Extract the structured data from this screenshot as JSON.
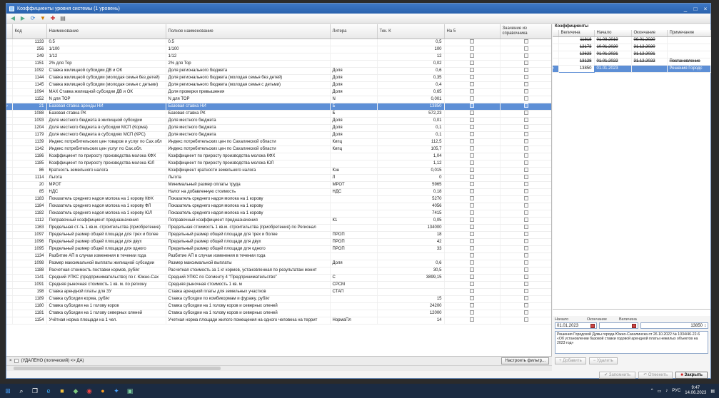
{
  "window": {
    "title": "Коэффициенты уровня системы (1 уровень)",
    "controls": [
      "_",
      "□",
      "×"
    ]
  },
  "toolbar": {
    "buttons": [
      "back-icon",
      "forward-icon",
      "refresh-icon",
      "filter-icon",
      "tools-icon",
      "print-icon"
    ]
  },
  "grid": {
    "columns": {
      "code": "Код",
      "name": "Наименование",
      "full_name": "Полное наименование",
      "litera": "Литера",
      "tek_k": "Тек. К",
      "na5": "На 5",
      "from_ref": "Значение из справочника"
    },
    "rows": [
      {
        "code": "1133",
        "name": "0.5",
        "full": "0.5",
        "lit": "",
        "k": "0,5"
      },
      {
        "code": "256",
        "name": "1/100",
        "full": "1/100",
        "lit": "",
        "k": "100"
      },
      {
        "code": "249",
        "name": "1/12",
        "full": "1/12",
        "lit": "",
        "k": "12"
      },
      {
        "code": "1151",
        "name": "2% для Тор",
        "full": "2% для Тор",
        "lit": "",
        "k": "0,02"
      },
      {
        "code": "1092",
        "name": "Ставка жилищной субсидии ДВ и ОК",
        "full": "Доля регионального бюджета",
        "lit": "Доля",
        "k": "0,6"
      },
      {
        "code": "1144",
        "name": "Ставка жилищной субсидии (молодая семья без детей)",
        "full": "Доля регионального бюджета (молодая семья без детей)",
        "lit": "Доля",
        "k": "0,35"
      },
      {
        "code": "1145",
        "name": "Ставка жилищной субсидии (молодая семья с детьми)",
        "full": "Доля регионального бюджета (молодая семья с детьми)",
        "lit": "Доля",
        "k": "0,4"
      },
      {
        "code": "1094",
        "name": "MAX Ставка жилищной субсидии ДВ и ОК",
        "full": "Доля проверки превышения",
        "lit": "Доля",
        "k": "0,65"
      },
      {
        "code": "1152",
        "name": "N для ТОР",
        "full": "N для ТОР",
        "lit": "N",
        "k": "0,001"
      },
      {
        "code": "21",
        "name": "Базовая ставка аренды НИ",
        "full": "Базовая ставка НИ",
        "lit": "Б",
        "k": "13850",
        "selected": true
      },
      {
        "code": "1088",
        "name": "Базовая ставка РК",
        "full": "Базовая ставка РК",
        "lit": "Б",
        "k": "572,23"
      },
      {
        "code": "1093",
        "name": "Доля местного бюджета в жилищной субсидии",
        "full": "Доля местного бюджета",
        "lit": "Доля",
        "k": "0,01"
      },
      {
        "code": "1204",
        "name": "Доля местного бюджета в субсидии МСП (Корма)",
        "full": "Доля местного бюджета",
        "lit": "Доля",
        "k": "0,1"
      },
      {
        "code": "1179",
        "name": "Доля местного бюджета в субсидиях МСП (КРС)",
        "full": "Доля местного бюджета",
        "lit": "Доля",
        "k": "0,1"
      },
      {
        "code": "1139",
        "name": "Индекс потребительских цен товаров и услуг по Сах.обл",
        "full": "Индекс потребительских цен по Сахалинской области",
        "lit": "Кипц",
        "k": "112,5"
      },
      {
        "code": "1142",
        "name": "Индекс потребительских цен услуг по Сах.обл.",
        "full": "Индекс потребительских цен по Сахалинской области",
        "lit": "Кипц",
        "k": "105,7"
      },
      {
        "code": "1186",
        "name": "Коэффициент по приросту производства молока КФХ",
        "full": "Коэффициент по приросту производства молока КФХ",
        "lit": "",
        "k": "1,04"
      },
      {
        "code": "1185",
        "name": "Коэффициент по приросту производства молока ЮЛ",
        "full": "Коэффициент по приросту производства молока ЮЛ",
        "lit": "",
        "k": "1,12"
      },
      {
        "code": "86",
        "name": "Кратность земельного налога",
        "full": "Коэффициент кратности земельного налога",
        "lit": "Кзн",
        "k": "0,015"
      },
      {
        "code": "1114",
        "name": "Льгота",
        "full": "Льгота",
        "lit": "Л",
        "k": "0"
      },
      {
        "code": "20",
        "name": "МРОТ",
        "full": "Минимальный размер оплаты труда",
        "lit": "МРОТ",
        "k": "5965"
      },
      {
        "code": "85",
        "name": "НДС",
        "full": "Налог на добавленную стоимость",
        "lit": "НДС",
        "k": "0,18"
      },
      {
        "code": "1183",
        "name": "Показатель среднего надоя молока на 1 корову КФХ",
        "full": "Показатель среднего надоя молока на 1 корову",
        "lit": "",
        "k": "5270"
      },
      {
        "code": "1184",
        "name": "Показатель среднего надоя молока на 1 корову ФЛ",
        "full": "Показатель среднего надоя молока на 1 корову",
        "lit": "",
        "k": "4056"
      },
      {
        "code": "1182",
        "name": "Показатель среднего надоя молока на 1 корову ЮЛ",
        "full": "Показатель среднего надоя молока на 1 корову",
        "lit": "",
        "k": "7415"
      },
      {
        "code": "1112",
        "name": "Поправочный коэффициент предназначения",
        "full": "Поправочный коэффициент предназначения",
        "lit": "К1",
        "k": "0,05"
      },
      {
        "code": "1163",
        "name": "Предельная ст-ть 1 кв.м. строительства (приобретение)",
        "full": "Предельная стоимость 1 кв.м. строительства (приобретения) по Регионал",
        "lit": "",
        "k": "134000"
      },
      {
        "code": "1097",
        "name": "Предельный размер общей площади для трех и более",
        "full": "Предельный размер общей площади для трех и более",
        "lit": "ПРОП",
        "k": "18"
      },
      {
        "code": "1096",
        "name": "Предельный размер общей площади для двух",
        "full": "Предельный размер общей площади для двух",
        "lit": "ПРОП",
        "k": "42"
      },
      {
        "code": "1095",
        "name": "Предельный размер общей площади для одного",
        "full": "Предельный размер общей площади для одного",
        "lit": "ПРОП",
        "k": "33"
      },
      {
        "code": "1134",
        "name": "Разбитие АП в случае изменения в течении года",
        "full": "Разбитие АП в случае изменения в течении года",
        "lit": "",
        "k": ""
      },
      {
        "code": "1098",
        "name": "Размер максимальной выплаты жилищной субсидии",
        "full": "Размер максимальной выплаты",
        "lit": "Доля",
        "k": "0,6"
      },
      {
        "code": "1188",
        "name": "Расчетная стоимость поставки кормов, руб/кг",
        "full": "Расчетная стоимость за 1 кг кормов, установленная по результатам монит",
        "lit": "",
        "k": "30,5"
      },
      {
        "code": "1141",
        "name": "Средний УПКС (предпринимательство) по г. Южно-Сах",
        "full": "Средний УПКС по Сегменту 4 \"Предпринимательство\"",
        "lit": "С",
        "k": "3899,15"
      },
      {
        "code": "1091",
        "name": "Средняя рыночная стоимость 1 кв. м. по региону",
        "full": "Средняя рыночная стоимость 1 кв. м",
        "lit": "СРСМ",
        "k": ""
      },
      {
        "code": "198",
        "name": "Ставка арендной платы для ЗУ",
        "full": "Ставка арендной платы для земельных участков",
        "lit": "СТАП",
        "k": ""
      },
      {
        "code": "1189",
        "name": "Ставка субсидии корма, руб/кг",
        "full": "Ставка субсидии по комбикормам и фуражу, руб/кг",
        "lit": "",
        "k": "15"
      },
      {
        "code": "1180",
        "name": "Ставка субсидии на 1 голову коров",
        "full": "Ставка субсидии на 1 голову коров и северных оленей",
        "lit": "",
        "k": "24200"
      },
      {
        "code": "1181",
        "name": "Ставка субсидии на 1 голову  северных оленей",
        "full": "Ставка субсидии на 1 голову коров и северных оленей",
        "lit": "",
        "k": "12000"
      },
      {
        "code": "1154",
        "name": "Учётная норма площади на 1 чел.",
        "full": "Учетная норма площади жилого помещения на одного человека на террит",
        "lit": "НормаПл",
        "k": "14"
      }
    ]
  },
  "filter": {
    "close": "×",
    "text": "(УДАЛЕНО (логический) <> ДА)",
    "settings_button": "Настроить фильтр..."
  },
  "right_panel": {
    "title": "Коэффициенты",
    "columns": {
      "value": "Величина",
      "start": "Начало",
      "end": "Окончание",
      "note": "Примечание"
    },
    "rows": [
      {
        "value": "11818",
        "start": "01.08.2019",
        "end": "09.01.2020",
        "note": "",
        "struck": true
      },
      {
        "value": "12173",
        "start": "10.01.2020",
        "end": "31.12.2020",
        "note": "",
        "struck": true
      },
      {
        "value": "12623",
        "start": "01.01.2021",
        "end": "31.12.2021",
        "note": "",
        "struck": true
      },
      {
        "value": "13128",
        "start": "01.01.2022",
        "end": "31.12.2022",
        "note": "Постановление",
        "struck": true
      },
      {
        "value": "13850",
        "start": "01.01.2023",
        "end": "",
        "note": "Решения Городс",
        "struck": false,
        "selected": true
      }
    ],
    "edit": {
      "label_start": "Начало",
      "label_end": "Окончание",
      "label_value": "Величина",
      "start": "01.01.2023",
      "end": "",
      "value": "13850",
      "memo": "Решения Городской Думы города Южно-Сахалинска от 26.10.2022 № 1034/46-22-6 «Об установлении базовой ставки годовой арендной платы нежилых объектов на 2023 год»"
    },
    "btn_add": "Добавить",
    "btn_delete": "Удалить"
  },
  "bottom_buttons": {
    "save": "Запомнить",
    "cancel": "Отменить",
    "close": "Закрыть"
  },
  "taskbar": {
    "lang": "РУС",
    "time": "9:47",
    "date": "14.06.2023"
  }
}
